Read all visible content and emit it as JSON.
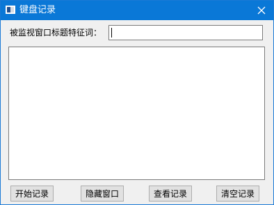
{
  "window": {
    "title": "键盘记录",
    "accent_color": "#0a78d7",
    "icons": {
      "app": "app-icon",
      "close": "close-icon"
    }
  },
  "filter": {
    "label": "被监视窗口标题特征词：",
    "value": ""
  },
  "log": {
    "content": ""
  },
  "buttons": {
    "start_label": "开始记录",
    "hide_label": "隐藏窗口",
    "view_label": "查看记录",
    "clear_label": "清空记录"
  }
}
